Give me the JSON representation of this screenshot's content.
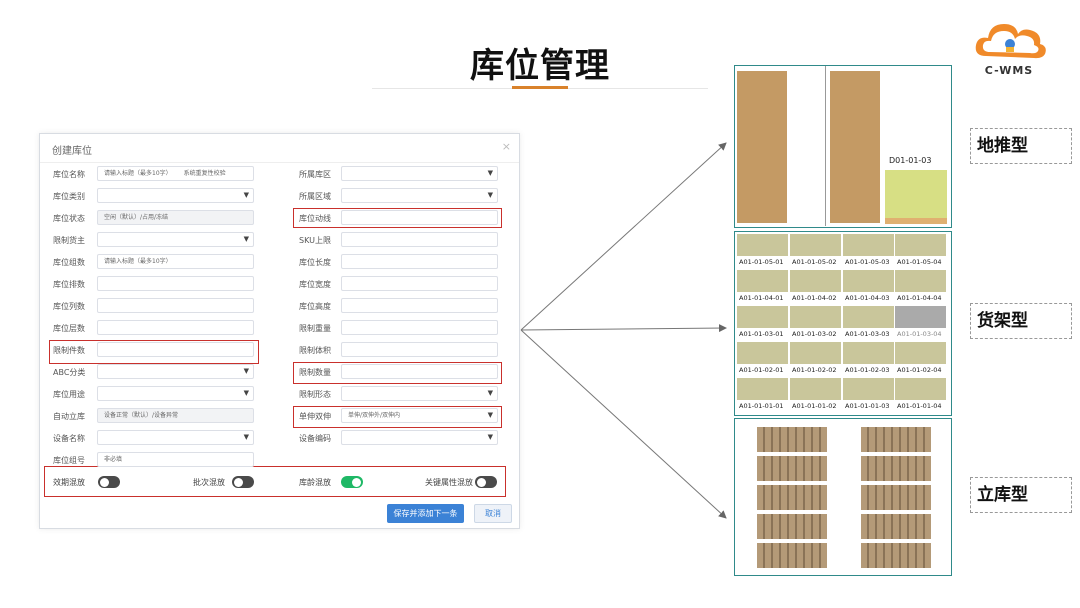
{
  "page": {
    "title": "库位管理",
    "logo_text": "C-WMS"
  },
  "dialog": {
    "title": "创建库位",
    "close": "×",
    "left_fields": [
      {
        "label": "库位名称",
        "value": "请输入标题（最多10字）",
        "value2": "系统重复性校验",
        "type": "text"
      },
      {
        "label": "库位类别",
        "value": "",
        "type": "select"
      },
      {
        "label": "库位状态",
        "value": "空闲（默认）/占用/冻结",
        "type": "disabled"
      },
      {
        "label": "限制货主",
        "value": "",
        "type": "select"
      },
      {
        "label": "库位组数",
        "value": "请输入标题（最多10字）",
        "type": "text"
      },
      {
        "label": "库位排数",
        "value": "",
        "type": "text"
      },
      {
        "label": "库位列数",
        "value": "",
        "type": "text"
      },
      {
        "label": "库位层数",
        "value": "",
        "type": "text"
      },
      {
        "label": "限制件数",
        "value": "",
        "type": "text"
      },
      {
        "label": "ABC分类",
        "value": "",
        "type": "select"
      },
      {
        "label": "库位用途",
        "value": "",
        "type": "select"
      },
      {
        "label": "自动立库",
        "value": "设备正常（默认）/设备异常",
        "type": "disabled"
      },
      {
        "label": "设备名称",
        "value": "",
        "type": "select"
      },
      {
        "label": "库位组号",
        "value": "非必填",
        "type": "text"
      }
    ],
    "right_fields": [
      {
        "label": "所属库区",
        "value": "",
        "type": "select"
      },
      {
        "label": "所属区域",
        "value": "",
        "type": "select"
      },
      {
        "label": "库位动线",
        "value": "",
        "type": "text"
      },
      {
        "label": "SKU上限",
        "value": "",
        "type": "text"
      },
      {
        "label": "库位长度",
        "value": "",
        "type": "text"
      },
      {
        "label": "库位宽度",
        "value": "",
        "type": "text"
      },
      {
        "label": "库位高度",
        "value": "",
        "type": "text"
      },
      {
        "label": "限制重量",
        "value": "",
        "type": "text"
      },
      {
        "label": "限制体积",
        "value": "",
        "type": "text"
      },
      {
        "label": "限制数量",
        "value": "",
        "type": "text"
      },
      {
        "label": "限制形态",
        "value": "",
        "type": "select"
      },
      {
        "label": "单伸双伸",
        "value": "单伸/双伸外/双伸内",
        "type": "select"
      },
      {
        "label": "设备编码",
        "value": "",
        "type": "select"
      }
    ],
    "toggles": [
      {
        "label": "效期混放",
        "on": false
      },
      {
        "label": "批次混放",
        "on": false
      },
      {
        "label": "库龄混放",
        "on": true
      },
      {
        "label": "关键属性混放",
        "on": false
      }
    ],
    "buttons": {
      "save": "保存并添加下一条",
      "cancel": "取消"
    }
  },
  "panels": {
    "floor": {
      "type_label": "地推型",
      "location_code": "D01-01-03"
    },
    "shelf": {
      "type_label": "货架型",
      "rows": [
        [
          "A01-01-05-01",
          "A01-01-05-02",
          "A01-01-05-03",
          "A01-01-05-04"
        ],
        [
          "A01-01-04-01",
          "A01-01-04-02",
          "A01-01-04-03",
          "A01-01-04-04"
        ],
        [
          "A01-01-03-01",
          "A01-01-03-02",
          "A01-01-03-03",
          "A01-01-03-04"
        ],
        [
          "A01-01-02-01",
          "A01-01-02-02",
          "A01-01-02-03",
          "A01-01-02-04"
        ],
        [
          "A01-01-01-01",
          "A01-01-01-02",
          "A01-01-01-03",
          "A01-01-01-04"
        ]
      ],
      "disabled_cell": "A01-01-03-04"
    },
    "asrs": {
      "type_label": "立库型"
    }
  },
  "colors": {
    "accent": "#d9822b",
    "highlight": "#c9302c",
    "primary": "#3b82d6",
    "panel_border": "#2f8a8a",
    "toggle_on": "#1fb866"
  }
}
